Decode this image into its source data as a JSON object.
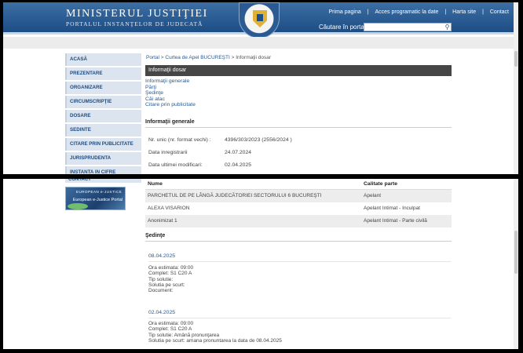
{
  "header": {
    "title": "MINISTERUL JUSTIŢIEI",
    "subtitle": "PORTALUL INSTANŢELOR DE JUDECATĂ",
    "top_links": [
      "Prima pagina",
      "Acces programatic la date",
      "Harta site",
      "Contact"
    ],
    "search_label": "Căutare în portal"
  },
  "sidebar": {
    "items": [
      "ACASĂ",
      "PREZENTARE",
      "ORGANIZARE",
      "CIRCUMSCRIPŢIE",
      "DOSARE",
      "SEDINTE",
      "CITARE PRIN PUBLICITATE",
      "JURISPRUDENTA",
      "INSTANTA IN CIFRE"
    ],
    "contact": "CONTACT",
    "banner_top": "EUROPEAN e-JUSTICE",
    "banner_text": "European e-Justice Portal"
  },
  "breadcrumb": {
    "portal": "Portal",
    "sep": ">",
    "court": "Curtea de Apel BUCUREŞTI",
    "current": "Informaţii dosar"
  },
  "section_bar": "Informaţii dosar",
  "anchor_links": [
    "Informaţii generale",
    "Părţi",
    "Şedinţe",
    "Căi atac",
    "Citare prin publicitate"
  ],
  "general": {
    "heading": "Informaţii generale",
    "rows": [
      {
        "label": "Nr. unic (nr. format vechi) :",
        "value": "4396/303/2023 (2556/2024 )"
      },
      {
        "label": "Data inregistrarii",
        "value": "24.07.2024"
      },
      {
        "label": "Data ultimei modificari:",
        "value": "02.04.2025"
      }
    ]
  },
  "parties": {
    "col_name": "Nume",
    "col_role": "Calitate parte",
    "rows": [
      {
        "name": "PARCHETUL DE PE LÂNGĂ JUDECĂTORIEI SECTORULUI 6 BUCUREŞTI",
        "role": "Apelant"
      },
      {
        "name": "ALEXA VISARION",
        "role": "Apelant Intimat - Inculpat"
      },
      {
        "name": "Anonimizat 1",
        "role": "Apelant Intimat - Parte civilă"
      }
    ]
  },
  "hearings": {
    "heading": "Şedinţe",
    "items": [
      {
        "date": "08.04.2025",
        "lines": [
          "Ora estimata: 09:00",
          "Complet: S1 C20 A",
          "Tip solutie:",
          "Solutia pe scurt:",
          "Document:"
        ]
      },
      {
        "date": "02.04.2025",
        "lines": [
          "Ora estimata: 09:00",
          "Complet: S1 C20 A",
          "Tip solutie: Amână pronunţarea",
          "Solutia pe scurt: amana pronuntarea la data de 08.04.2025"
        ]
      }
    ]
  },
  "colors": {
    "header_blue": "#1c4d85",
    "link_blue": "#2a5a91",
    "section_bar": "#464646"
  }
}
